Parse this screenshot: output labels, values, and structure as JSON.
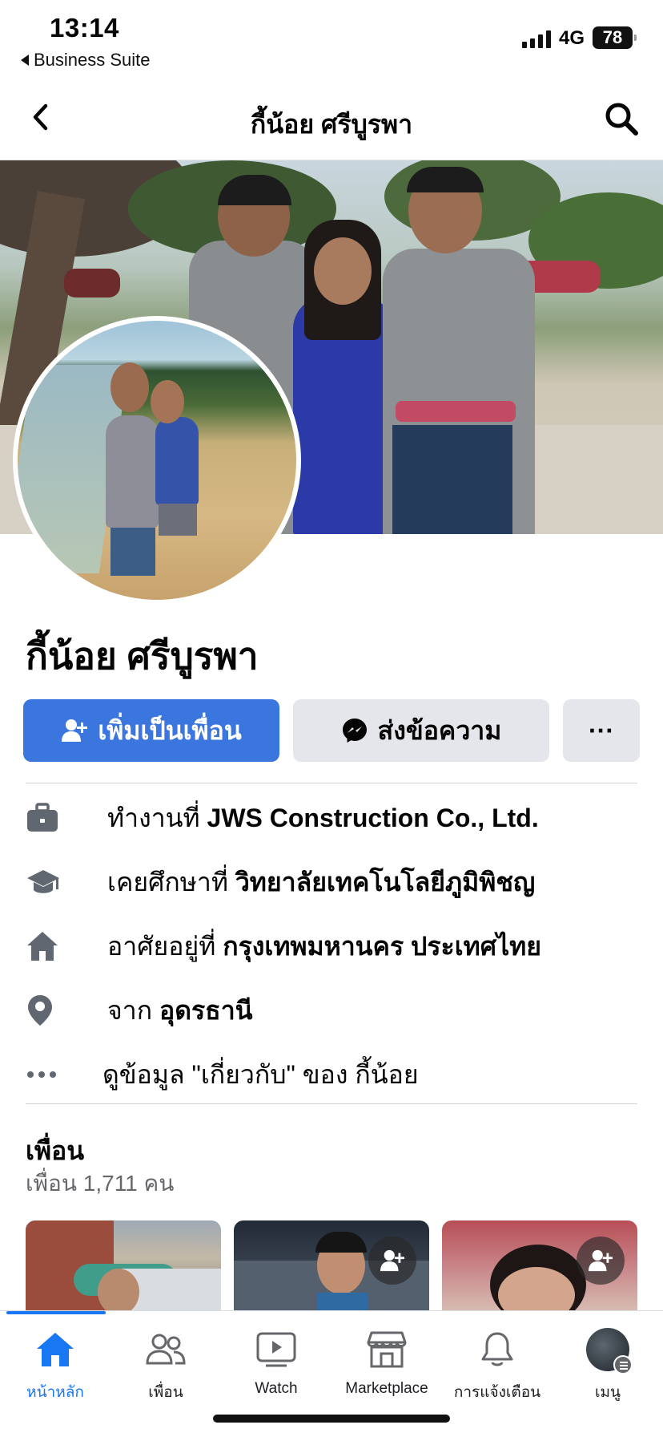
{
  "status_bar": {
    "time": "13:14",
    "back_app": "Business Suite",
    "network": "4G",
    "battery": "78"
  },
  "nav": {
    "title": "กี้น้อย ศรีบูรพา",
    "back_icon": "chevron-left-icon",
    "search_icon": "search-icon"
  },
  "profile": {
    "name": "กี้น้อย ศรีบูรพา"
  },
  "actions": {
    "add_friend": "เพิ่มเป็นเพื่อน",
    "message": "ส่งข้อความ",
    "more": "···"
  },
  "info": [
    {
      "icon": "briefcase-icon",
      "prefix": "ทำงานที่ ",
      "value": "JWS Construction Co., Ltd."
    },
    {
      "icon": "graduation-cap-icon",
      "prefix": "เคยศึกษาที่ ",
      "value": "วิทยาลัยเทคโนโลยีภูมิพิชญ"
    },
    {
      "icon": "home-icon",
      "prefix": "อาศัยอยู่ที่ ",
      "value": "กรุงเทพมหานคร ประเทศไทย"
    },
    {
      "icon": "location-pin-icon",
      "prefix": "จาก ",
      "value": "อุดรธานี"
    },
    {
      "icon": "more-dots-icon",
      "prefix": "ดูข้อมูล \"เกี่ยวกับ\" ของ กี้น้อย",
      "value": ""
    }
  ],
  "friends": {
    "title": "เพื่อน",
    "count": "เพื่อน 1,711 คน"
  },
  "tabs": [
    {
      "label": "หน้าหลัก",
      "icon": "home-icon",
      "active": true
    },
    {
      "label": "เพื่อน",
      "icon": "friends-icon",
      "active": false
    },
    {
      "label": "Watch",
      "icon": "watch-icon",
      "active": false
    },
    {
      "label": "Marketplace",
      "icon": "marketplace-icon",
      "active": false
    },
    {
      "label": "การแจ้งเตือน",
      "icon": "bell-icon",
      "active": false
    },
    {
      "label": "เมนู",
      "icon": "menu-avatar-icon",
      "active": false
    }
  ],
  "colors": {
    "accent": "#1877f2",
    "add_friend_button": "#3b76de",
    "secondary_button": "#e4e6eb",
    "muted_text": "#65676b"
  }
}
